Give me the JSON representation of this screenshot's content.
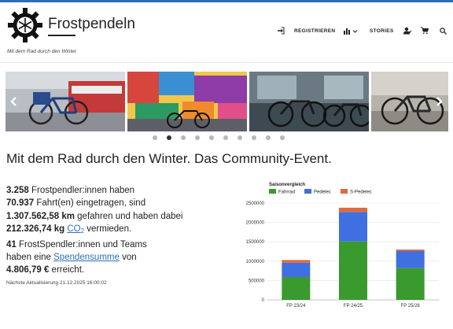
{
  "site": {
    "title": "Frostpendeln",
    "tagline": "Mit dem Rad durch den Winter"
  },
  "nav": {
    "items": [
      {
        "label": "",
        "icon": "sign-in-icon"
      },
      {
        "label": "REGISTRIEREN"
      },
      {
        "label": "",
        "icon": "bar-chart-icon"
      },
      {
        "label": "STORIES"
      },
      {
        "label": "",
        "icon": "user-icon"
      },
      {
        "label": "",
        "icon": "cart-icon"
      },
      {
        "label": "",
        "icon": "search-icon"
      }
    ]
  },
  "slider": {
    "slides": [
      "bike-on-train-platform",
      "colorful-mural-with-bike",
      "bikes-in-front-of-shop",
      "bike-on-street"
    ],
    "dot_count": 10,
    "active_dot": 1
  },
  "main": {
    "heading": "Mit dem Rad durch den Winter. Das Community-Event.",
    "stats": {
      "commuters_value": "3.258",
      "commuters_text": " Frostpendler:innen haben",
      "trips_value": "70.937",
      "trips_text": " Fahrt(en) eingetragen, sind",
      "km_value": "1.307.562,58 km",
      "km_text": " gefahren und haben dabei",
      "co2_value": "212.326,74 kg",
      "co2_link": "CO",
      "co2_sub": "2",
      "co2_text": " vermieden.",
      "teams_value": "41",
      "teams_text": " FrostSpendler:innen und Teams",
      "donation_prefix": "haben eine ",
      "donation_link": "Spendensumme",
      "donation_mid": " von",
      "donation_value": "4.806,79 €",
      "donation_suffix": " erreicht."
    },
    "updated": "Nächste Aktualisierung 21.12.2025 16:00:02"
  },
  "colors": {
    "accent": "#2c6fb5",
    "fahrrad": "#3a9a2e",
    "pedelec": "#3f6fe0",
    "spedelec": "#e06a3c"
  },
  "chart_data": {
    "type": "bar",
    "stacked": true,
    "title": "Saisonvergleich",
    "categories": [
      "FP 23/24",
      "FP 24/25",
      "FP 25/26"
    ],
    "series": [
      {
        "name": "Fahrrad",
        "values": [
          590000,
          1510000,
          820000
        ]
      },
      {
        "name": "Pedelec",
        "values": [
          370000,
          760000,
          440000
        ]
      },
      {
        "name": "S-Pedelec",
        "values": [
          70000,
          110000,
          40000
        ]
      }
    ],
    "ylim": [
      0,
      2500000
    ],
    "yticks": [
      0,
      500000,
      1000000,
      1500000,
      2000000,
      2500000
    ],
    "grid": true,
    "legend": "top"
  }
}
